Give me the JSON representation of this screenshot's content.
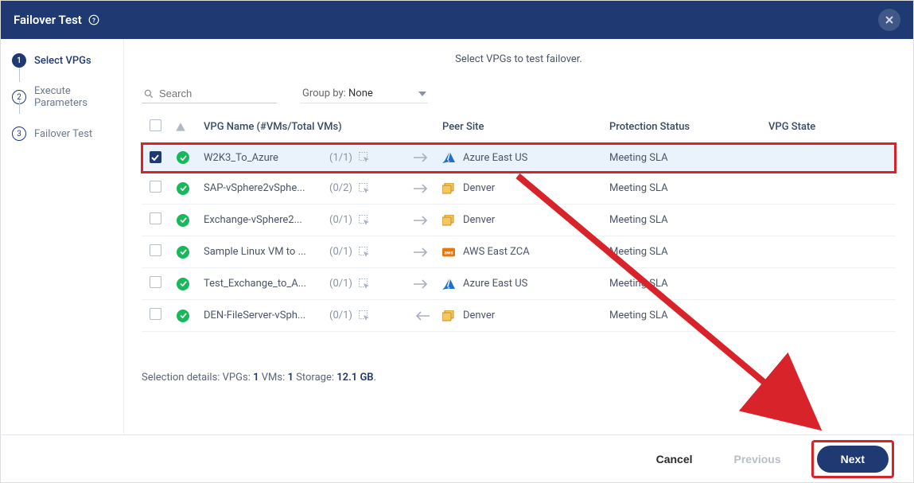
{
  "header": {
    "title": "Failover Test"
  },
  "steps": [
    {
      "label": "Select VPGs",
      "active": true
    },
    {
      "label": "Execute Parameters",
      "active": false
    },
    {
      "label": "Failover Test",
      "active": false
    }
  ],
  "subtitle": "Select VPGs to test failover.",
  "search": {
    "placeholder": "Search"
  },
  "groupby": {
    "label": "Group by:",
    "value": "None"
  },
  "columns": {
    "name": "VPG Name (#VMs/Total VMs)",
    "peer": "Peer Site",
    "protection": "Protection Status",
    "state": "VPG State"
  },
  "rows": [
    {
      "checked": true,
      "highlight": true,
      "name": "W2K3_To_Azure",
      "vms": "(1/1)",
      "dir": "right",
      "site_type": "azure",
      "peer": "Azure East US",
      "protection": "Meeting SLA"
    },
    {
      "checked": false,
      "highlight": false,
      "name": "SAP-vSphere2vSphe...",
      "vms": "(0/2)",
      "dir": "right",
      "site_type": "vsphere",
      "peer": "Denver",
      "protection": "Meeting SLA"
    },
    {
      "checked": false,
      "highlight": false,
      "name": "Exchange-vSphere2...",
      "vms": "(0/1)",
      "dir": "right",
      "site_type": "vsphere",
      "peer": "Denver",
      "protection": "Meeting SLA"
    },
    {
      "checked": false,
      "highlight": false,
      "name": "Sample Linux VM to ...",
      "vms": "(0/1)",
      "dir": "right",
      "site_type": "aws",
      "peer": "AWS East ZCA",
      "protection": "Meeting SLA"
    },
    {
      "checked": false,
      "highlight": false,
      "name": "Test_Exchange_to_A...",
      "vms": "(0/1)",
      "dir": "right",
      "site_type": "azure",
      "peer": "Azure East US",
      "protection": "Meeting SLA"
    },
    {
      "checked": false,
      "highlight": false,
      "name": "DEN-FileServer-vSph...",
      "vms": "(0/1)",
      "dir": "left",
      "site_type": "vsphere",
      "peer": "Denver",
      "protection": "Meeting SLA"
    }
  ],
  "selection": {
    "prefix": "Selection details: VPGs:",
    "vpgs": "1",
    "vms_label": "VMs:",
    "vms": "1",
    "storage_label": "Storage:",
    "storage": "12.1 GB",
    "suffix": "."
  },
  "footer": {
    "cancel": "Cancel",
    "previous": "Previous",
    "next": "Next"
  }
}
